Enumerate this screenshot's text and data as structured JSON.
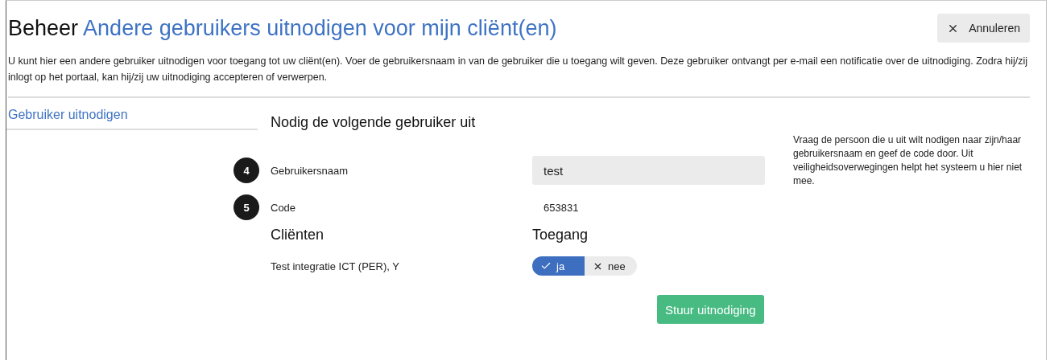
{
  "header": {
    "section": "Beheer",
    "title": "Andere gebruikers uitnodigen voor mijn cliënt(en)",
    "cancel_button": "Annuleren"
  },
  "description": "U kunt hier een andere gebruiker uitnodigen voor toegang tot uw cliënt(en). Voer de gebruikersnaam in van de gebruiker die u toegang wilt geven. Deze gebruiker ontvangt per e-mail een notificatie over de uitnodiging. Zodra hij/zij inlogt op het portaal, kan hij/zij uw uitnodiging accepteren of verwerpen.",
  "sidebar": {
    "items": [
      {
        "label": "Gebruiker uitnodigen",
        "selected": true
      }
    ]
  },
  "form": {
    "heading": "Nodig de volgende gebruiker uit",
    "fields": [
      {
        "step": "4",
        "label": "Gebruikersnaam",
        "kind": "input",
        "value": "test"
      },
      {
        "step": "5",
        "label": "Code",
        "kind": "text",
        "value": "653831"
      }
    ],
    "help": "Vraag de persoon die u uit wilt nodigen naar zijn/haar gebruikersnaam en geef de code door. Uit veiligheidsoverwegingen helpt het systeem u hier niet mee.",
    "clients_heading": "Cliënten",
    "access_heading": "Toegang",
    "clients": [
      {
        "name": "Test integratie ICT (PER), Y",
        "options": [
          {
            "label": "ja",
            "kind": "yes",
            "selected": true
          },
          {
            "label": "nee",
            "kind": "no",
            "selected": false
          }
        ]
      }
    ],
    "submit_button": "Stuur uitnodiging"
  }
}
